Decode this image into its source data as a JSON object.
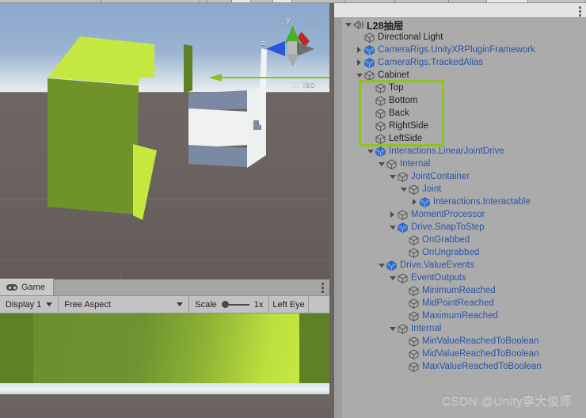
{
  "window": {
    "accent_green": "#8ec220",
    "hierarchy_bg": "#ababab",
    "scene_ground": "#6b6360"
  },
  "scene_view": {
    "gizmo": {
      "projection_label": "Iso",
      "axis_y": "y",
      "axis_z": "z",
      "icon": "hamburger-icon"
    },
    "annotation": {
      "kind": "arrow-left",
      "color": "#8ec220"
    }
  },
  "game_panel": {
    "tab": {
      "label": "Game",
      "icon": "gamepad-icon"
    },
    "kebab": "kebab-menu-icon",
    "toolbar": {
      "display": {
        "label": "Display 1",
        "icon": "chevron-down-icon"
      },
      "aspect": {
        "label": "Free Aspect",
        "icon": "chevron-down-icon"
      },
      "scale": {
        "label": "Scale",
        "value": "1x"
      },
      "eye": {
        "label": "Left Eye"
      }
    }
  },
  "hierarchy": {
    "header": {
      "title": "L28抽屉",
      "icon": "scene-icon",
      "kebab": "kebab-menu-icon"
    },
    "rows": [
      {
        "depth": 0,
        "twirl": "open",
        "icon": "scene-icon",
        "label": "L28抽屉",
        "style": "bold",
        "header": true
      },
      {
        "depth": 1,
        "twirl": "none",
        "icon": "gameobject-icon",
        "label": "Directional Light",
        "style": "dark"
      },
      {
        "depth": 1,
        "twirl": "closed",
        "icon": "prefab-icon",
        "label": "CameraRigs.UnityXRPluginFramework",
        "style": "blue"
      },
      {
        "depth": 1,
        "twirl": "closed",
        "icon": "prefab-icon",
        "label": "CameraRigs.TrackedAlias",
        "style": "blue"
      },
      {
        "depth": 1,
        "twirl": "open",
        "icon": "gameobject-icon",
        "label": "Cabinet",
        "style": "dark"
      },
      {
        "depth": 2,
        "twirl": "none",
        "icon": "gameobject-icon",
        "label": "Top",
        "style": "dark"
      },
      {
        "depth": 2,
        "twirl": "none",
        "icon": "gameobject-icon",
        "label": "Bottom",
        "style": "dark"
      },
      {
        "depth": 2,
        "twirl": "none",
        "icon": "gameobject-icon",
        "label": "Back",
        "style": "dark"
      },
      {
        "depth": 2,
        "twirl": "none",
        "icon": "gameobject-icon",
        "label": "RightSide",
        "style": "dark"
      },
      {
        "depth": 2,
        "twirl": "none",
        "icon": "gameobject-icon",
        "label": "LeftSide",
        "style": "dark"
      },
      {
        "depth": 2,
        "twirl": "open",
        "icon": "prefab-icon",
        "label": "Interactions.LinearJointDrive",
        "style": "blue"
      },
      {
        "depth": 3,
        "twirl": "open",
        "icon": "gameobject-icon",
        "label": "Internal",
        "style": "blue"
      },
      {
        "depth": 4,
        "twirl": "open",
        "icon": "gameobject-icon",
        "label": "JointContainer",
        "style": "blue"
      },
      {
        "depth": 5,
        "twirl": "open",
        "icon": "gameobject-icon",
        "label": "Joint",
        "style": "blue"
      },
      {
        "depth": 6,
        "twirl": "closed",
        "icon": "prefab-icon",
        "label": "Interactions.Interactable",
        "style": "blue"
      },
      {
        "depth": 4,
        "twirl": "closed",
        "icon": "gameobject-icon",
        "label": "MomentProcessor",
        "style": "blue"
      },
      {
        "depth": 4,
        "twirl": "open",
        "icon": "prefab-icon",
        "label": "Drive.SnapToStep",
        "style": "blue"
      },
      {
        "depth": 5,
        "twirl": "none",
        "icon": "gameobject-icon",
        "label": "OnGrabbed",
        "style": "blue"
      },
      {
        "depth": 5,
        "twirl": "none",
        "icon": "gameobject-icon",
        "label": "OnUngrabbed",
        "style": "blue"
      },
      {
        "depth": 3,
        "twirl": "open",
        "icon": "prefab-icon",
        "label": "Drive.ValueEvents",
        "style": "blue"
      },
      {
        "depth": 4,
        "twirl": "open",
        "icon": "gameobject-icon",
        "label": "EventOutputs",
        "style": "blue"
      },
      {
        "depth": 5,
        "twirl": "none",
        "icon": "gameobject-icon",
        "label": "MinimumReached",
        "style": "blue"
      },
      {
        "depth": 5,
        "twirl": "none",
        "icon": "gameobject-icon",
        "label": "MidPointReached",
        "style": "blue"
      },
      {
        "depth": 5,
        "twirl": "none",
        "icon": "gameobject-icon",
        "label": "MaximumReached",
        "style": "blue"
      },
      {
        "depth": 4,
        "twirl": "open",
        "icon": "gameobject-icon",
        "label": "Internal",
        "style": "blue"
      },
      {
        "depth": 5,
        "twirl": "none",
        "icon": "gameobject-icon",
        "label": "MinValueReachedToBoolean",
        "style": "blue"
      },
      {
        "depth": 5,
        "twirl": "none",
        "icon": "gameobject-icon",
        "label": "MidValueReachedToBoolean",
        "style": "blue"
      },
      {
        "depth": 5,
        "twirl": "none",
        "icon": "gameobject-icon",
        "label": "MaxValueReachedToBoolean",
        "style": "blue"
      }
    ],
    "annotation": {
      "first_row_index": 5,
      "last_row_index": 9,
      "color": "#8ec220"
    }
  },
  "watermark": {
    "text": "CSDN @Unity李大俊师"
  }
}
